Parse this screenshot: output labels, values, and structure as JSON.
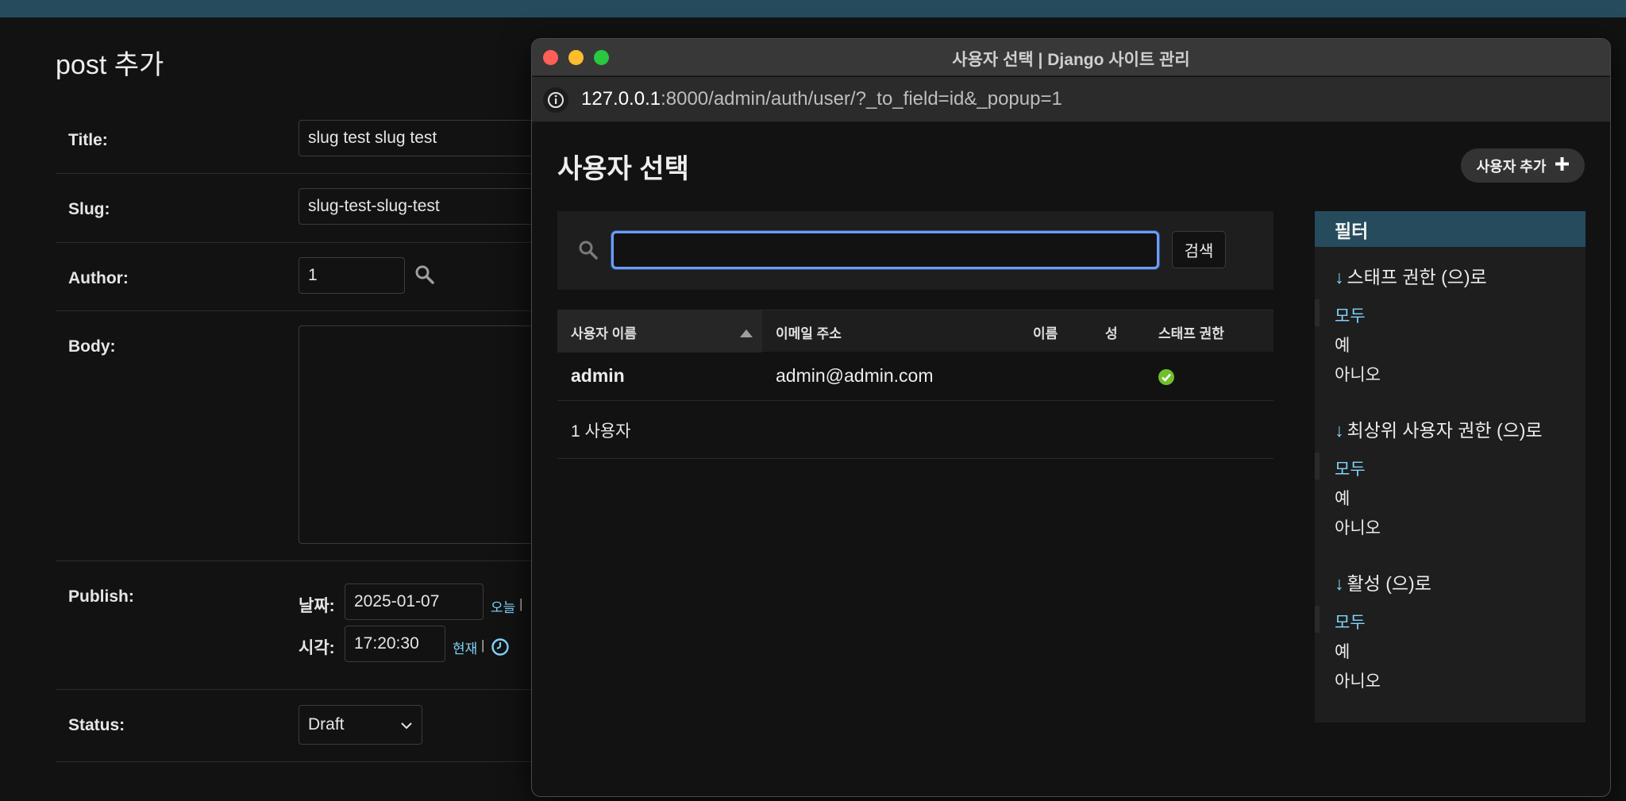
{
  "form": {
    "page_title": "post 추가",
    "fields": {
      "title": {
        "label": "Title:",
        "value": "slug test slug test"
      },
      "slug": {
        "label": "Slug:",
        "value": "slug-test-slug-test"
      },
      "author": {
        "label": "Author:",
        "value": "1"
      },
      "body": {
        "label": "Body:",
        "value": ""
      },
      "publish": {
        "label": "Publish:",
        "date_label": "날짜:",
        "date_value": "2025-01-07",
        "date_shortcut": "오늘",
        "date_sep": "|",
        "time_label": "시각:",
        "time_value": "17:20:30",
        "time_shortcut": "현재",
        "time_sep": "|"
      },
      "status": {
        "label": "Status:",
        "value": "Draft"
      }
    }
  },
  "popup": {
    "window_title": "사용자 선택 | Django 사이트 관리",
    "url_host": "127.0.0.1",
    "url_rest": ":8000/admin/auth/user/?_to_field=id&_popup=1",
    "page_title": "사용자 선택",
    "add_button": "사용자 추가",
    "search": {
      "value": "",
      "button": "검색"
    },
    "table": {
      "headers": [
        "사용자 이름",
        "이메일 주소",
        "이름",
        "성",
        "스태프 권한"
      ],
      "rows": [
        {
          "username": "admin",
          "email": "admin@admin.com",
          "first_name": "",
          "last_name": "",
          "is_staff": true
        }
      ],
      "count_text": "1 사용자"
    },
    "filter": {
      "header": "필터",
      "arrow": "↓",
      "groups": [
        {
          "title": "스태프 권한 (으)로",
          "options": [
            "모두",
            "예",
            "아니오"
          ],
          "selected": 0
        },
        {
          "title": "최상위 사용자 권한 (으)로",
          "options": [
            "모두",
            "예",
            "아니오"
          ],
          "selected": 0
        },
        {
          "title": "활성 (으)로",
          "options": [
            "모두",
            "예",
            "아니오"
          ],
          "selected": 0
        }
      ]
    }
  },
  "colors": {
    "accent": "#81d4fa",
    "header_bar": "#264b5d",
    "success": "#70bf2b"
  }
}
